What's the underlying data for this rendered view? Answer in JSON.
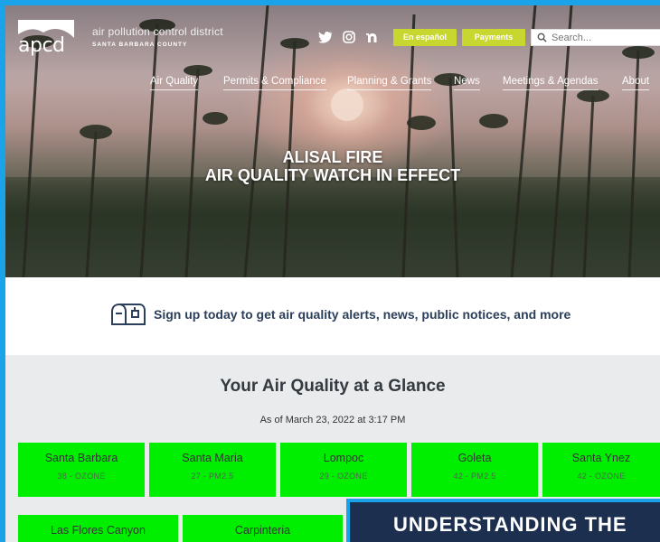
{
  "logo": {
    "mark_text": "apcd",
    "line1": "air pollution control district",
    "line2": "SANTA BARBARA COUNTY"
  },
  "social": [
    "twitter-icon",
    "instagram-icon",
    "nextdoor-icon"
  ],
  "buttons": {
    "espanol": "En español",
    "payments": "Payments"
  },
  "search": {
    "placeholder": "Search..."
  },
  "nav": [
    "Air Quality",
    "Permits & Compliance",
    "Planning & Grants",
    "News",
    "Meetings & Agendas",
    "About"
  ],
  "hero": {
    "line1": "ALISAL FIRE",
    "line2": "AIR QUALITY WATCH IN EFFECT"
  },
  "signup": {
    "text": "Sign up today to get air quality alerts, news, public notices, and more"
  },
  "glance": {
    "title": "Your Air Quality at a Glance",
    "as_of": "As of March 23, 2022 at 3:17 PM",
    "stations": [
      {
        "name": "Santa Barbara",
        "value": "38 - OZONE"
      },
      {
        "name": "Santa Maria",
        "value": "27 - PM2.5"
      },
      {
        "name": "Lompoc",
        "value": "29 - OZONE"
      },
      {
        "name": "Goleta",
        "value": "42 - PM2.5"
      },
      {
        "name": "Santa Ynez",
        "value": "42 - OZONE"
      },
      {
        "name": "Las Flores Canyon",
        "value": ""
      },
      {
        "name": "Carpinteria",
        "value": ""
      }
    ],
    "good_color": "#00ee00"
  },
  "understand": {
    "title": "UNDERSTANDING THE"
  },
  "colors": {
    "accent": "#1aa3e8",
    "button": "#c8d630",
    "navy": "#1d2f4f",
    "text_dark": "#2b3f5a"
  }
}
